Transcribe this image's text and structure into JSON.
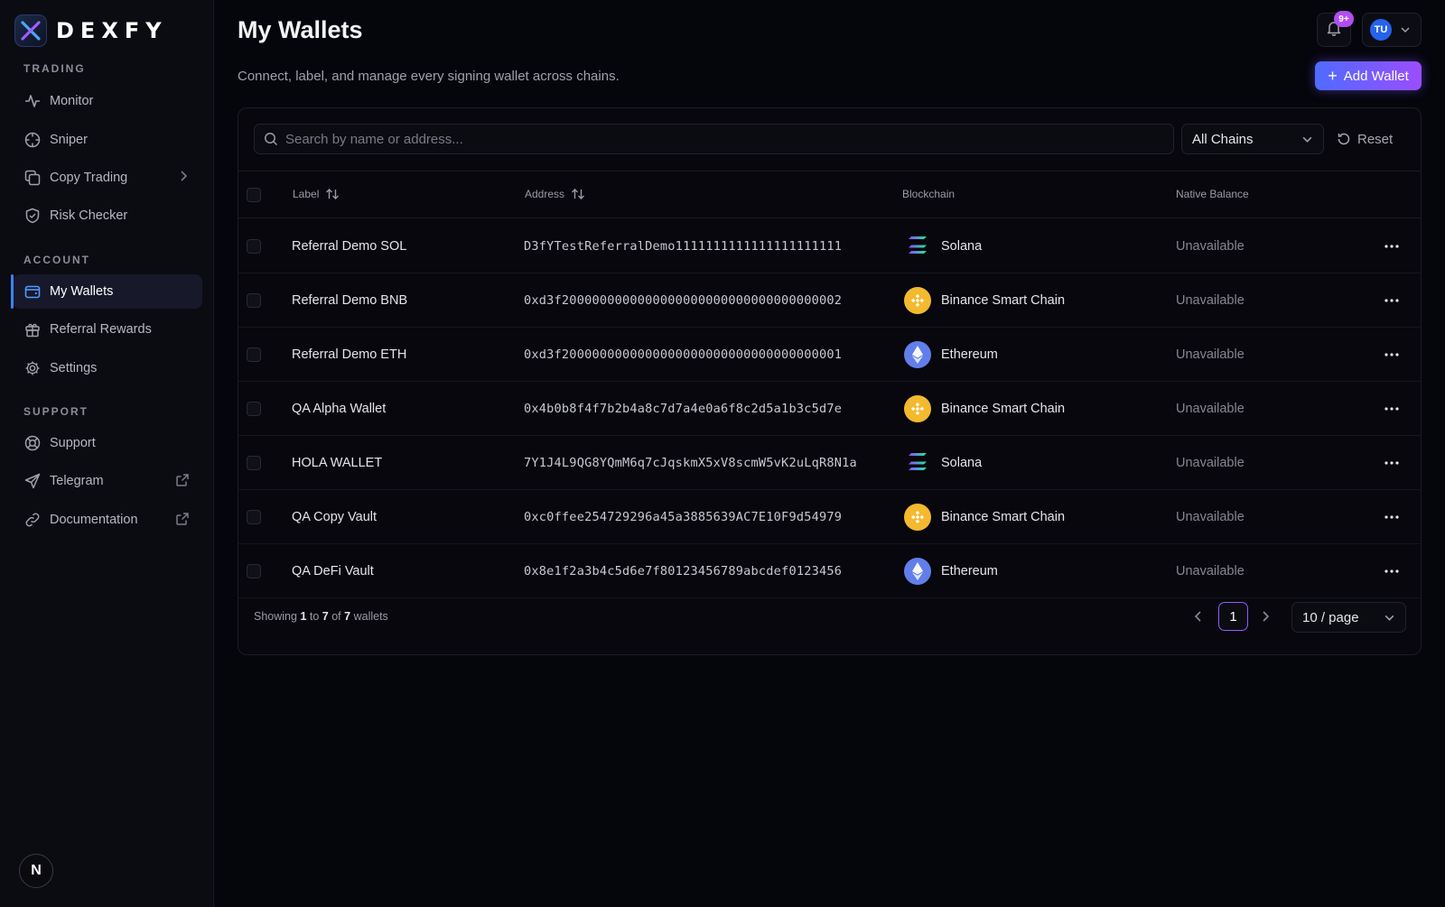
{
  "brand": {
    "name": "DEXFY"
  },
  "sidebar": {
    "sections": [
      {
        "label": "TRADING",
        "items": [
          {
            "label": "Monitor",
            "icon": "activity-icon"
          },
          {
            "label": "Sniper",
            "icon": "crosshair-icon"
          },
          {
            "label": "Copy Trading",
            "icon": "copy-icon",
            "trailing": "chevron-right-icon"
          },
          {
            "label": "Risk Checker",
            "icon": "shield-check-icon"
          }
        ]
      },
      {
        "label": "ACCOUNT",
        "items": [
          {
            "label": "My Wallets",
            "icon": "wallet-icon",
            "active": true
          },
          {
            "label": "Referral Rewards",
            "icon": "gift-icon"
          },
          {
            "label": "Settings",
            "icon": "gear-icon"
          }
        ]
      },
      {
        "label": "SUPPORT",
        "items": [
          {
            "label": "Support",
            "icon": "lifebuoy-icon"
          },
          {
            "label": "Telegram",
            "icon": "send-icon",
            "trailing": "external-link-icon"
          },
          {
            "label": "Documentation",
            "icon": "link-icon",
            "trailing": "external-link-icon"
          }
        ]
      }
    ],
    "corner_badge": "N"
  },
  "header": {
    "title": "My Wallets",
    "subtitle": "Connect, label, and manage every signing wallet across chains.",
    "notification_badge": "9+",
    "user_initials": "TU",
    "add_button_label": "Add Wallet"
  },
  "filters": {
    "search_placeholder": "Search by name or address...",
    "chain_select": "All Chains",
    "reset_label": "Reset"
  },
  "table": {
    "columns": [
      "Label",
      "Address",
      "Blockchain",
      "Native Balance"
    ],
    "rows": [
      {
        "label": "Referral Demo SOL",
        "address": "D3fYTestReferralDemo1111111111111111111111",
        "chain": "Solana",
        "balance": "Unavailable"
      },
      {
        "label": "Referral Demo BNB",
        "address": "0xd3f2000000000000000000000000000000000002",
        "chain": "Binance Smart Chain",
        "balance": "Unavailable"
      },
      {
        "label": "Referral Demo ETH",
        "address": "0xd3f2000000000000000000000000000000000001",
        "chain": "Ethereum",
        "balance": "Unavailable"
      },
      {
        "label": "QA Alpha Wallet",
        "address": "0x4b0b8f4f7b2b4a8c7d7a4e0a6f8c2d5a1b3c5d7e",
        "chain": "Binance Smart Chain",
        "balance": "Unavailable"
      },
      {
        "label": "HOLA WALLET",
        "address": "7Y1J4L9QG8YQmM6q7cJqskmX5xV8scmW5vK2uLqR8N1a",
        "chain": "Solana",
        "balance": "Unavailable"
      },
      {
        "label": "QA Copy Vault",
        "address": "0xc0ffee254729296a45a3885639AC7E10F9d54979",
        "chain": "Binance Smart Chain",
        "balance": "Unavailable"
      },
      {
        "label": "QA DeFi Vault",
        "address": "0x8e1f2a3b4c5d6e7f80123456789abcdef0123456",
        "chain": "Ethereum",
        "balance": "Unavailable"
      }
    ]
  },
  "pagination": {
    "showing_prefix": "Showing",
    "from": "1",
    "to_word": "to",
    "to": "7",
    "of_word": "of",
    "total": "7",
    "suffix": "wallets",
    "current_page": "1",
    "per_page": "10 / page"
  },
  "colors": {
    "accent": "#3b82f6",
    "button_gradient_start": "#4f6bff",
    "button_gradient_end": "#9b4dff",
    "badge": "#b24df2",
    "bnb": "#f3ba2f",
    "eth": "#627eea"
  }
}
